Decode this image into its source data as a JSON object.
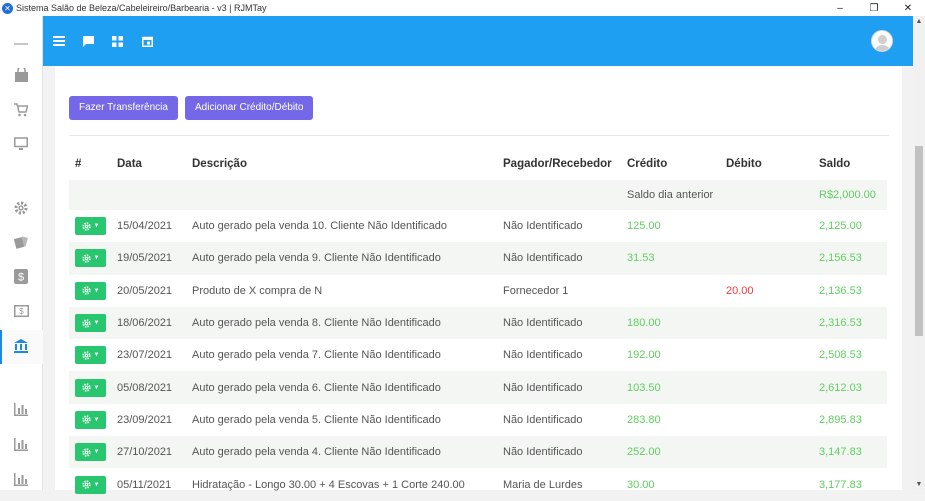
{
  "window": {
    "title": "Sistema Salão de Beleza/Cabeleireiro/Barbearia - v3 | RJMTay",
    "minimize": "–",
    "maximize": "❐",
    "close": "✕"
  },
  "actions": {
    "transfer": "Fazer Transferência",
    "add_credit_debit": "Adicionar Crédito/Débito"
  },
  "table": {
    "headers": {
      "num": "#",
      "date": "Data",
      "desc": "Descrição",
      "payer": "Pagador/Recebedor",
      "credit": "Crédito",
      "debit": "Débito",
      "balance": "Saldo"
    },
    "previous": {
      "label": "Saldo dia anterior",
      "balance": "R$2,000.00"
    },
    "rows": [
      {
        "date": "15/04/2021",
        "desc": "Auto gerado pela venda 10. Cliente Não Identificado",
        "payer": "Não Identificado",
        "credit": "125.00",
        "debit": "",
        "balance": "2,125.00"
      },
      {
        "date": "19/05/2021",
        "desc": "Auto gerado pela venda 9. Cliente Não Identificado",
        "payer": "Não Identificado",
        "credit": "31.53",
        "debit": "",
        "balance": "2,156.53"
      },
      {
        "date": "20/05/2021",
        "desc": "Produto de X compra de N",
        "payer": "Fornecedor 1",
        "credit": "",
        "debit": "20.00",
        "balance": "2,136.53"
      },
      {
        "date": "18/06/2021",
        "desc": "Auto gerado pela venda 8. Cliente Não Identificado",
        "payer": "Não Identificado",
        "credit": "180.00",
        "debit": "",
        "balance": "2,316.53"
      },
      {
        "date": "23/07/2021",
        "desc": "Auto gerado pela venda 7. Cliente Não Identificado",
        "payer": "Não Identificado",
        "credit": "192.00",
        "debit": "",
        "balance": "2,508.53"
      },
      {
        "date": "05/08/2021",
        "desc": "Auto gerado pela venda 6. Cliente Não Identificado",
        "payer": "Não Identificado",
        "credit": "103.50",
        "debit": "",
        "balance": "2,612.03"
      },
      {
        "date": "23/09/2021",
        "desc": "Auto gerado pela venda 5. Cliente Não Identificado",
        "payer": "Não Identificado",
        "credit": "283.80",
        "debit": "",
        "balance": "2,895.83"
      },
      {
        "date": "27/10/2021",
        "desc": "Auto gerado pela venda 4. Cliente Não Identificado",
        "payer": "Não Identificado",
        "credit": "252.00",
        "debit": "",
        "balance": "3,147.83"
      },
      {
        "date": "05/11/2021",
        "desc": "Hidratação - Longo 30.00 + 4 Escovas + 1 Corte 240.00",
        "payer": "Maria de Lurdes",
        "credit": "30.00",
        "debit": "",
        "balance": "3,177.83"
      }
    ]
  },
  "colors": {
    "topbar": "#1e9ff2",
    "accent_purple": "#7468e8",
    "action_green": "#28c76f",
    "credit_green": "#5fcf5f",
    "debit_red": "#ee3b3b"
  },
  "icons": {
    "sidebar": [
      "dash-icon",
      "shopping-bag-icon",
      "cart-icon",
      "monitor-icon",
      "gear-icon",
      "cards-icon",
      "dollar-box-icon",
      "money-icon",
      "bank-icon",
      "bar-chart-icon",
      "bar-chart-icon",
      "bar-chart-icon"
    ],
    "topbar": [
      "menu-icon",
      "chat-icon",
      "grid-icon",
      "calendar-icon"
    ]
  }
}
